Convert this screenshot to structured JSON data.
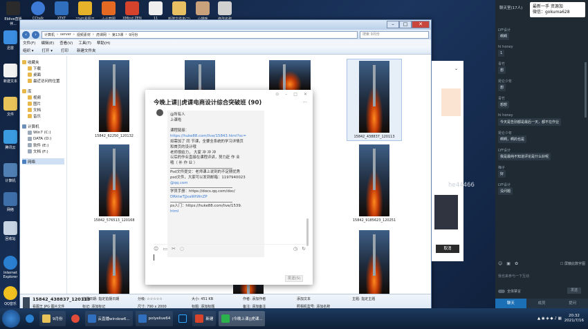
{
  "desktop": {
    "top_icons": [
      "Eblive直播伴...",
      "CCtalk",
      "XTKT",
      "2345看图王",
      "小北截图",
      "XMind ZEN",
      "11",
      "新建文件夹(2)",
      "小猫咪",
      "修改名称"
    ],
    "left_icons": [
      "迅雷",
      "新建文本",
      "文件",
      "腾讯云",
      "计算机",
      "网络",
      "回收站",
      "Internet Explorer",
      "QQ音乐"
    ]
  },
  "explorer": {
    "address": [
      "计算机",
      "server",
      "视频素材",
      "虎课网",
      "第13课",
      "9月份"
    ],
    "search_placeholder": "搜索 9月份",
    "menu": [
      "文件(F)",
      "编辑(E)",
      "查看(V)",
      "工具(T)",
      "帮助(H)"
    ],
    "toolbar": [
      "组织 ▾",
      "打开 ▾",
      "打印",
      "新建文件夹"
    ],
    "sidebar": {
      "favorites": [
        "收藏夹",
        "下载",
        "桌面",
        "最近访问的位置"
      ],
      "library": [
        "库",
        "视频",
        "图片",
        "文档",
        "音乐"
      ],
      "computer": [
        "计算机",
        "Win7 (C:)",
        "DATA (D:)",
        "软件 (E:)",
        "文档 (F:)"
      ],
      "network": "网络"
    },
    "thumbnails": [
      "15842_62250_120132",
      "",
      "",
      "15842_438837_120113",
      "",
      "",
      "",
      "15842_576513_120168",
      "",
      "",
      "",
      "15842_9185623_120251"
    ],
    "details": {
      "filename": "15842_438837_120113",
      "type": "看图王 JPG 图片文件",
      "date_taken_label": "拍摄日期:",
      "date_taken_value": "指定拍摄日期",
      "tags_label": "标记:",
      "tags_value": "添加标记",
      "rating_label": "分级:",
      "dimensions_label": "尺寸:",
      "dimensions_value": "790 x 2000",
      "size_label": "大小:",
      "size_value": "451 KB",
      "title_label": "标题:",
      "title_value": "添加标题",
      "authors_label": "作者:",
      "authors_value": "添加作者",
      "comments_label": "备注:",
      "comments_value": "添加备注",
      "subject_label": "主题:",
      "subject_value": "指定主题",
      "date_created_label": "创建日期:",
      "date_created_value": "2021/7/14 22:49",
      "camera_label": "照相机型号:",
      "camera_value": "添加名称",
      "extra": "添加文本"
    }
  },
  "chat": {
    "title": "今晚上课||虎课电商设计综合突破班 (90)",
    "message": [
      "@所有人",
      "上课啦",
      "",
      "课程链接：",
      "https://huke88.com/live/15843.html?sc=",
      "如需加了 同 节课，全要全系统的学习详情页",
      "和首页的设计哦",
      "老师很给力，  大家 冲 冲 冲",
      "以后的作业直接在课程评讲，努力赶 作 业",
      "哦（  补  作  业  ）",
      "",
      "Psd文件提交：老师课上说到的不定期优秀",
      "psd文件，大家可以发到邮箱：1197940023",
      "@qq.com",
      "",
      "学员手册：https://docs.qq.com/doc/",
      "DRktwTJJxaWtWnZP",
      "",
      "ps入门：https://huke88.com/live/1539.",
      "html"
    ],
    "send_label": "发送(S)"
  },
  "side_panel": {
    "header": "聊天室(17人)",
    "watermark_line1": "最新一手 资源加",
    "watermark_line2": "微信：gokuma628",
    "messages": [
      {
        "name": "LYF设计",
        "text": "啊啊"
      },
      {
        "name": "hi honey",
        "text": "1"
      },
      {
        "name": "青竹",
        "text": "想"
      },
      {
        "name": "昆仑少年",
        "text": "想"
      },
      {
        "name": "青竹",
        "text": "想想"
      },
      {
        "name": "hi honey",
        "text": "今天是告别都是最后一天，都不在作业"
      },
      {
        "name": "昆仑少年",
        "text": "啊啊，啊的也是"
      },
      {
        "name": "LYF设计",
        "text": "我是最纯不知道评论是什么好呢"
      },
      {
        "name": "梅子",
        "text": "好"
      },
      {
        "name": "LYF设计",
        "text": "没问题"
      }
    ],
    "checkbox_label": "屏蔽此数字图",
    "input_placeholder": "我也来参与一下互动",
    "toggle_label": "全体禁言",
    "send": "发送",
    "tabs": [
      "聊天",
      "成员",
      "提问"
    ]
  },
  "bg_window_cancel": "取消",
  "overlay_label": "he44466",
  "taskbar": {
    "items": [
      "9月份",
      "云直播window6...",
      "polyelive64",
      "",
      "新建",
      "(今晚上课||虎课..."
    ],
    "time": "20:32",
    "date": "2021/7/16"
  },
  "colors": {
    "accent": "#1a6fb5",
    "link": "#3b7bd4",
    "panel_bg": "#1f2a33"
  }
}
